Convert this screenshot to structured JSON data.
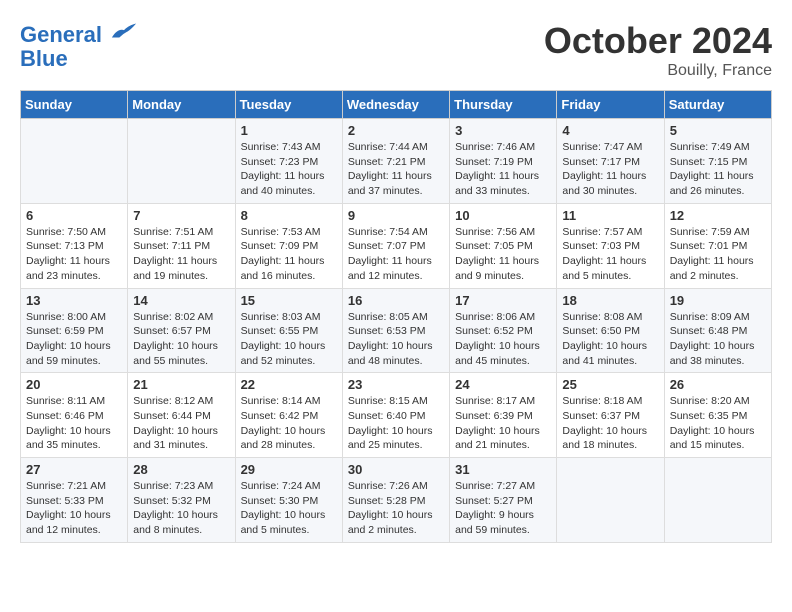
{
  "header": {
    "logo_line1": "General",
    "logo_line2": "Blue",
    "month_title": "October 2024",
    "location": "Bouilly, France"
  },
  "days_of_week": [
    "Sunday",
    "Monday",
    "Tuesday",
    "Wednesday",
    "Thursday",
    "Friday",
    "Saturday"
  ],
  "weeks": [
    [
      {
        "day": "",
        "info": ""
      },
      {
        "day": "",
        "info": ""
      },
      {
        "day": "1",
        "info": "Sunrise: 7:43 AM\nSunset: 7:23 PM\nDaylight: 11 hours and 40 minutes."
      },
      {
        "day": "2",
        "info": "Sunrise: 7:44 AM\nSunset: 7:21 PM\nDaylight: 11 hours and 37 minutes."
      },
      {
        "day": "3",
        "info": "Sunrise: 7:46 AM\nSunset: 7:19 PM\nDaylight: 11 hours and 33 minutes."
      },
      {
        "day": "4",
        "info": "Sunrise: 7:47 AM\nSunset: 7:17 PM\nDaylight: 11 hours and 30 minutes."
      },
      {
        "day": "5",
        "info": "Sunrise: 7:49 AM\nSunset: 7:15 PM\nDaylight: 11 hours and 26 minutes."
      }
    ],
    [
      {
        "day": "6",
        "info": "Sunrise: 7:50 AM\nSunset: 7:13 PM\nDaylight: 11 hours and 23 minutes."
      },
      {
        "day": "7",
        "info": "Sunrise: 7:51 AM\nSunset: 7:11 PM\nDaylight: 11 hours and 19 minutes."
      },
      {
        "day": "8",
        "info": "Sunrise: 7:53 AM\nSunset: 7:09 PM\nDaylight: 11 hours and 16 minutes."
      },
      {
        "day": "9",
        "info": "Sunrise: 7:54 AM\nSunset: 7:07 PM\nDaylight: 11 hours and 12 minutes."
      },
      {
        "day": "10",
        "info": "Sunrise: 7:56 AM\nSunset: 7:05 PM\nDaylight: 11 hours and 9 minutes."
      },
      {
        "day": "11",
        "info": "Sunrise: 7:57 AM\nSunset: 7:03 PM\nDaylight: 11 hours and 5 minutes."
      },
      {
        "day": "12",
        "info": "Sunrise: 7:59 AM\nSunset: 7:01 PM\nDaylight: 11 hours and 2 minutes."
      }
    ],
    [
      {
        "day": "13",
        "info": "Sunrise: 8:00 AM\nSunset: 6:59 PM\nDaylight: 10 hours and 59 minutes."
      },
      {
        "day": "14",
        "info": "Sunrise: 8:02 AM\nSunset: 6:57 PM\nDaylight: 10 hours and 55 minutes."
      },
      {
        "day": "15",
        "info": "Sunrise: 8:03 AM\nSunset: 6:55 PM\nDaylight: 10 hours and 52 minutes."
      },
      {
        "day": "16",
        "info": "Sunrise: 8:05 AM\nSunset: 6:53 PM\nDaylight: 10 hours and 48 minutes."
      },
      {
        "day": "17",
        "info": "Sunrise: 8:06 AM\nSunset: 6:52 PM\nDaylight: 10 hours and 45 minutes."
      },
      {
        "day": "18",
        "info": "Sunrise: 8:08 AM\nSunset: 6:50 PM\nDaylight: 10 hours and 41 minutes."
      },
      {
        "day": "19",
        "info": "Sunrise: 8:09 AM\nSunset: 6:48 PM\nDaylight: 10 hours and 38 minutes."
      }
    ],
    [
      {
        "day": "20",
        "info": "Sunrise: 8:11 AM\nSunset: 6:46 PM\nDaylight: 10 hours and 35 minutes."
      },
      {
        "day": "21",
        "info": "Sunrise: 8:12 AM\nSunset: 6:44 PM\nDaylight: 10 hours and 31 minutes."
      },
      {
        "day": "22",
        "info": "Sunrise: 8:14 AM\nSunset: 6:42 PM\nDaylight: 10 hours and 28 minutes."
      },
      {
        "day": "23",
        "info": "Sunrise: 8:15 AM\nSunset: 6:40 PM\nDaylight: 10 hours and 25 minutes."
      },
      {
        "day": "24",
        "info": "Sunrise: 8:17 AM\nSunset: 6:39 PM\nDaylight: 10 hours and 21 minutes."
      },
      {
        "day": "25",
        "info": "Sunrise: 8:18 AM\nSunset: 6:37 PM\nDaylight: 10 hours and 18 minutes."
      },
      {
        "day": "26",
        "info": "Sunrise: 8:20 AM\nSunset: 6:35 PM\nDaylight: 10 hours and 15 minutes."
      }
    ],
    [
      {
        "day": "27",
        "info": "Sunrise: 7:21 AM\nSunset: 5:33 PM\nDaylight: 10 hours and 12 minutes."
      },
      {
        "day": "28",
        "info": "Sunrise: 7:23 AM\nSunset: 5:32 PM\nDaylight: 10 hours and 8 minutes."
      },
      {
        "day": "29",
        "info": "Sunrise: 7:24 AM\nSunset: 5:30 PM\nDaylight: 10 hours and 5 minutes."
      },
      {
        "day": "30",
        "info": "Sunrise: 7:26 AM\nSunset: 5:28 PM\nDaylight: 10 hours and 2 minutes."
      },
      {
        "day": "31",
        "info": "Sunrise: 7:27 AM\nSunset: 5:27 PM\nDaylight: 9 hours and 59 minutes."
      },
      {
        "day": "",
        "info": ""
      },
      {
        "day": "",
        "info": ""
      }
    ]
  ]
}
